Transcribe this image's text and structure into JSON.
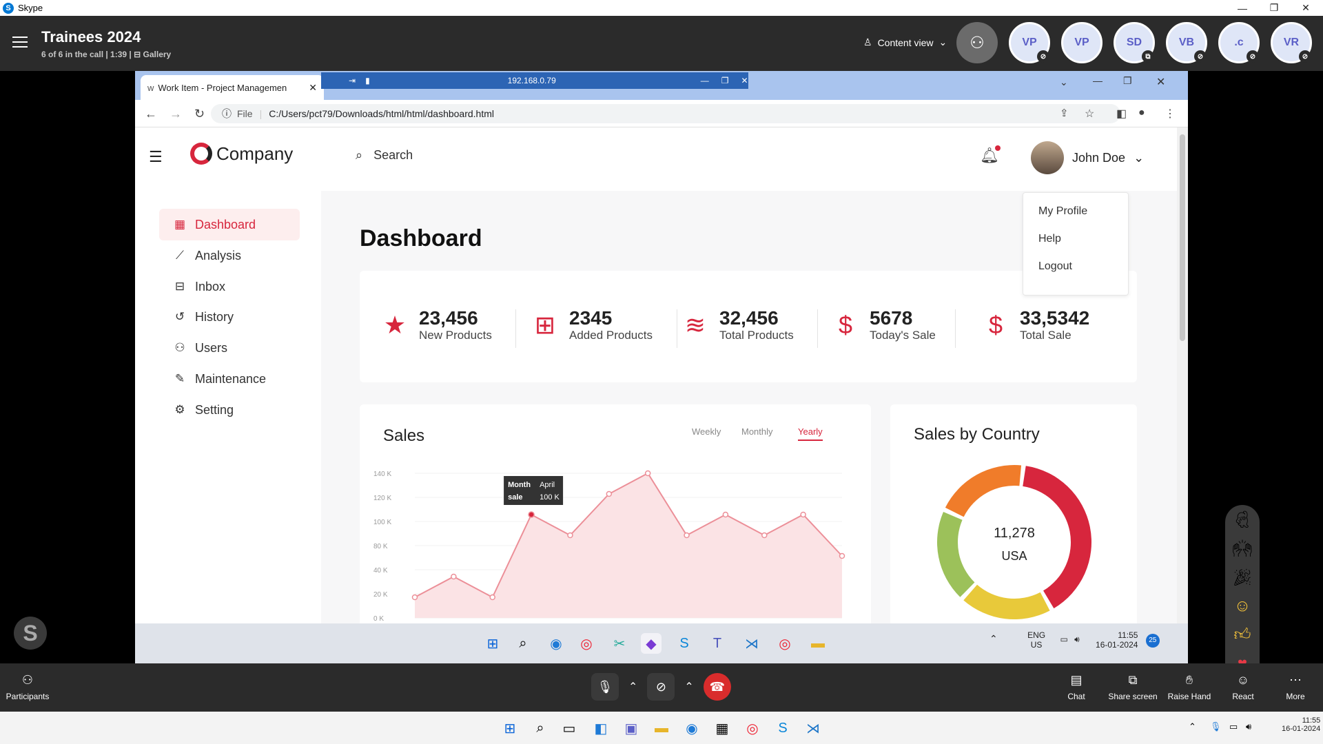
{
  "skype_window": {
    "title": "Skype"
  },
  "call": {
    "title": "Trainees 2024",
    "subtitle": "6 of 6 in the call | 1:39 |",
    "view_mode": "Gallery",
    "content_view_label": "Content view",
    "participants": [
      {
        "initials": "VP"
      },
      {
        "initials": "VP"
      },
      {
        "initials": "SD"
      },
      {
        "initials": "VB"
      },
      {
        "initials": ".c"
      },
      {
        "initials": "VR"
      }
    ]
  },
  "browser": {
    "tab_title": "Work Item - Project Managemen",
    "remote_address": "192.168.0.79",
    "url_prefix": "File",
    "url": "C:/Users/pct79/Downloads/html/html/dashboard.html"
  },
  "app": {
    "brand": "Company",
    "search_placeholder": "Search",
    "user_name": "John Doe",
    "user_menu": [
      "My Profile",
      "Help",
      "Logout"
    ],
    "sidebar": [
      {
        "label": "Dashboard",
        "icon": "grid-icon",
        "active": true
      },
      {
        "label": "Analysis",
        "icon": "analysis-icon"
      },
      {
        "label": "Inbox",
        "icon": "inbox-icon"
      },
      {
        "label": "History",
        "icon": "history-icon"
      },
      {
        "label": "Users",
        "icon": "users-icon"
      },
      {
        "label": "Maintenance",
        "icon": "maintenance-icon"
      },
      {
        "label": "Setting",
        "icon": "gear-icon"
      }
    ],
    "page_title": "Dashboard",
    "stats": [
      {
        "value": "23,456",
        "label": "New Products",
        "icon": "star-icon"
      },
      {
        "value": "2345",
        "label": "Added Products",
        "icon": "add-box-icon"
      },
      {
        "value": "32,456",
        "label": "Total Products",
        "icon": "layers-icon"
      },
      {
        "value": "5678",
        "label": "Today's Sale",
        "icon": "dollar-icon"
      },
      {
        "value": "33,5342",
        "label": "Total Sale",
        "icon": "money-bag-icon"
      }
    ],
    "sales": {
      "title": "Sales",
      "periods": [
        "Weekly",
        "Monthly",
        "Yearly"
      ],
      "active_period": "Yearly",
      "tooltip": {
        "month_label": "Month",
        "month": "April",
        "sale_label": "sale",
        "sale": "100 K"
      }
    },
    "country": {
      "title": "Sales by Country",
      "value": "11,278",
      "label": "USA"
    },
    "accent_color": "#d7263d"
  },
  "chart_data": [
    {
      "type": "area",
      "title": "Sales",
      "y_ticks": [
        "140 K",
        "120 K",
        "100 K",
        "80 K",
        "40 K",
        "20 K",
        "0 K"
      ],
      "ylim": [
        0,
        140
      ],
      "series": [
        {
          "values": [
            20,
            40,
            20,
            100,
            80,
            120,
            140,
            80,
            100,
            80,
            100,
            60
          ]
        }
      ]
    },
    {
      "type": "pie",
      "title": "Sales by Country",
      "slices": [
        {
          "color": "#d7263d",
          "value": 40
        },
        {
          "color": "#e8c93a",
          "value": 20
        },
        {
          "color": "#9cc15a",
          "value": 20
        },
        {
          "color": "#f07c2a",
          "value": 20
        }
      ]
    }
  ],
  "remote_taskbar": {
    "lang": "ENG",
    "region": "US",
    "time": "11:55",
    "date": "16-01-2024",
    "badge": "25"
  },
  "skype_bottom": {
    "participants": "Participants",
    "chat": "Chat",
    "share_screen": "Share screen",
    "raise_hand": "Raise Hand",
    "react": "React",
    "more": "More"
  },
  "local_taskbar": {
    "time": "11:55",
    "date": "16-01-2024"
  }
}
